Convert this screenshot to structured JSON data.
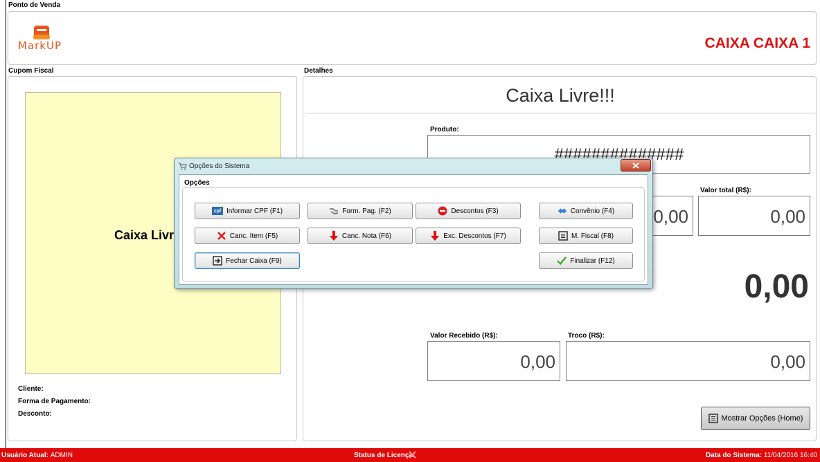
{
  "window": {
    "title": "Ponto de Venda",
    "caixa_label": "CAIXA CAIXA 1",
    "brand_color": "#e01010"
  },
  "logo": {
    "text": "MarkUP"
  },
  "cupom": {
    "section_title": "Cupom Fiscal",
    "receipt_text": "Caixa Livre!!!",
    "cliente_label": "Cliente:",
    "forma_pagamento_label": "Forma de Pagamento:",
    "desconto_label": "Desconto:"
  },
  "detalhes": {
    "section_title": "Detalhes",
    "status_title": "Caixa Livre!!!",
    "produto_label": "Produto:",
    "produto_value": "##############",
    "valor_unit_value": "0,00",
    "valor_total_label": "Valor total (R$):",
    "valor_total_value": "0,00",
    "total_big": "0,00",
    "valor_recebido_label": "Valor Recebido (R$):",
    "valor_recebido_value": "0,00",
    "troco_label": "Troco (R$):",
    "troco_value": "0,00",
    "mostrar_opcoes_label": "Mostrar Opções (Home)"
  },
  "dialog": {
    "title": "Opções do Sistema",
    "group_title": "Opções",
    "buttons": {
      "cpf": "Informar CPF (F1)",
      "form_pag": "Form. Pag. (F2)",
      "descontos": "Descontos (F3)",
      "convenio": "Convênio (F4)",
      "canc_item": "Canc. Item (F5)",
      "canc_nota": "Canc. Nota (F6)",
      "exc_descontos": "Exc. Descontos (F7)",
      "m_fiscal": "M. Fiscal (F8)",
      "fechar_caixa": "Fechar Caixa (F9)",
      "finalizar": "Finalizar (F12)"
    },
    "cpf_icon_text": "cpf"
  },
  "status_bar": {
    "usuario_label": "Usuário Atual:",
    "usuario_value": "ADMIN",
    "licenca_label": "Status de Licença:",
    "data_label": "Data do Sistema:",
    "data_value": "11/04/2016",
    "hora_value": "16:40"
  }
}
